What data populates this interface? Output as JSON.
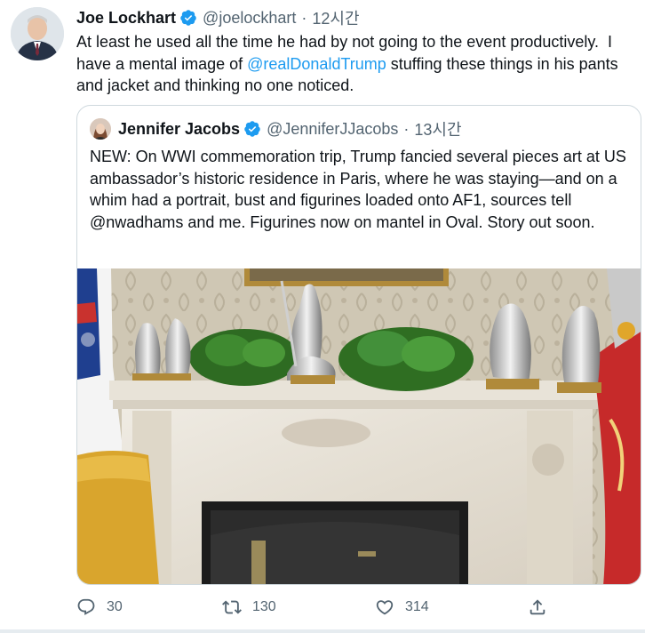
{
  "tweet": {
    "author": {
      "name": "Joe Lockhart",
      "handle": "@joelockhart",
      "separator": "·",
      "time": "12시간"
    },
    "text_before": "At least he used all the time he had by not going to the event productively.  I have a mental image of ",
    "mention": "@realDonaldTrump",
    "text_after": " stuffing these things in his pants and jacket and thinking no one noticed."
  },
  "quote": {
    "author": {
      "name": "Jennifer Jacobs",
      "handle": "@JenniferJJacobs",
      "separator": "·",
      "time": "13시간"
    },
    "text": "NEW: On WWI commemoration trip, Trump fancied several pieces art at US ambassador’s historic residence in Paris, where he was staying—and on a whim had a portrait, bust and figurines loaded onto AF1, sources tell @nwadhams and me. Figurines now on mantel in Oval. Story out soon."
  },
  "actions": {
    "replies": "30",
    "retweets": "130",
    "likes": "314"
  },
  "icons": {
    "verified": "verified-badge-icon",
    "reply": "reply-icon",
    "retweet": "retweet-icon",
    "like": "heart-icon",
    "share": "share-icon"
  },
  "colors": {
    "accent": "#1d9bf0",
    "secondary_text": "#536471",
    "border": "#cfd9de"
  }
}
